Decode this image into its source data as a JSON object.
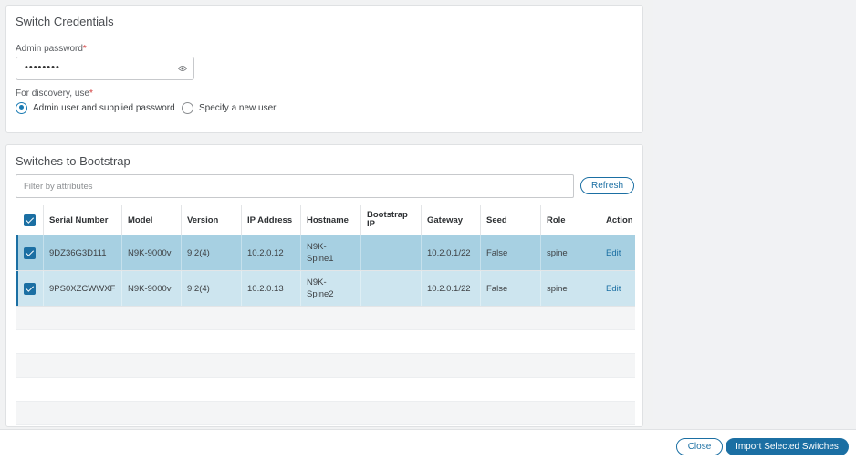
{
  "credentials": {
    "title": "Switch Credentials",
    "admin_password_label": "Admin password",
    "required_mark": "*",
    "admin_password_value": "••••••••",
    "discovery_label": "For discovery, use",
    "options": [
      {
        "label": "Admin user and supplied password",
        "selected": true
      },
      {
        "label": "Specify a new user",
        "selected": false
      }
    ]
  },
  "bootstrap": {
    "title": "Switches to Bootstrap",
    "filter_placeholder": "Filter by attributes",
    "refresh_label": "Refresh",
    "columns": [
      "Serial Number",
      "Model",
      "Version",
      "IP Address",
      "Hostname",
      "Bootstrap IP",
      "Gateway",
      "Seed",
      "Role",
      "Action"
    ],
    "rows": [
      {
        "checked": true,
        "serial": "9DZ36G3D111",
        "model": "N9K-9000v",
        "version": "9.2(4)",
        "ip": "10.2.0.12",
        "hostname": "N9K-Spine1",
        "bootstrap_ip": "",
        "gateway": "10.2.0.1/22",
        "seed": "False",
        "role": "spine",
        "action": "Edit"
      },
      {
        "checked": true,
        "serial": "9PS0XZCWWXF",
        "model": "N9K-9000v",
        "version": "9.2(4)",
        "ip": "10.2.0.13",
        "hostname": "N9K-Spine2",
        "bootstrap_ip": "",
        "gateway": "10.2.0.1/22",
        "seed": "False",
        "role": "spine",
        "action": "Edit"
      }
    ]
  },
  "footer": {
    "close_label": "Close",
    "import_label": "Import Selected Switches"
  },
  "colors": {
    "accent": "#1b6fa3",
    "selected_row": "#a7d0e2",
    "selected_row_alt": "#cde5ef",
    "required": "#d23b3b"
  }
}
